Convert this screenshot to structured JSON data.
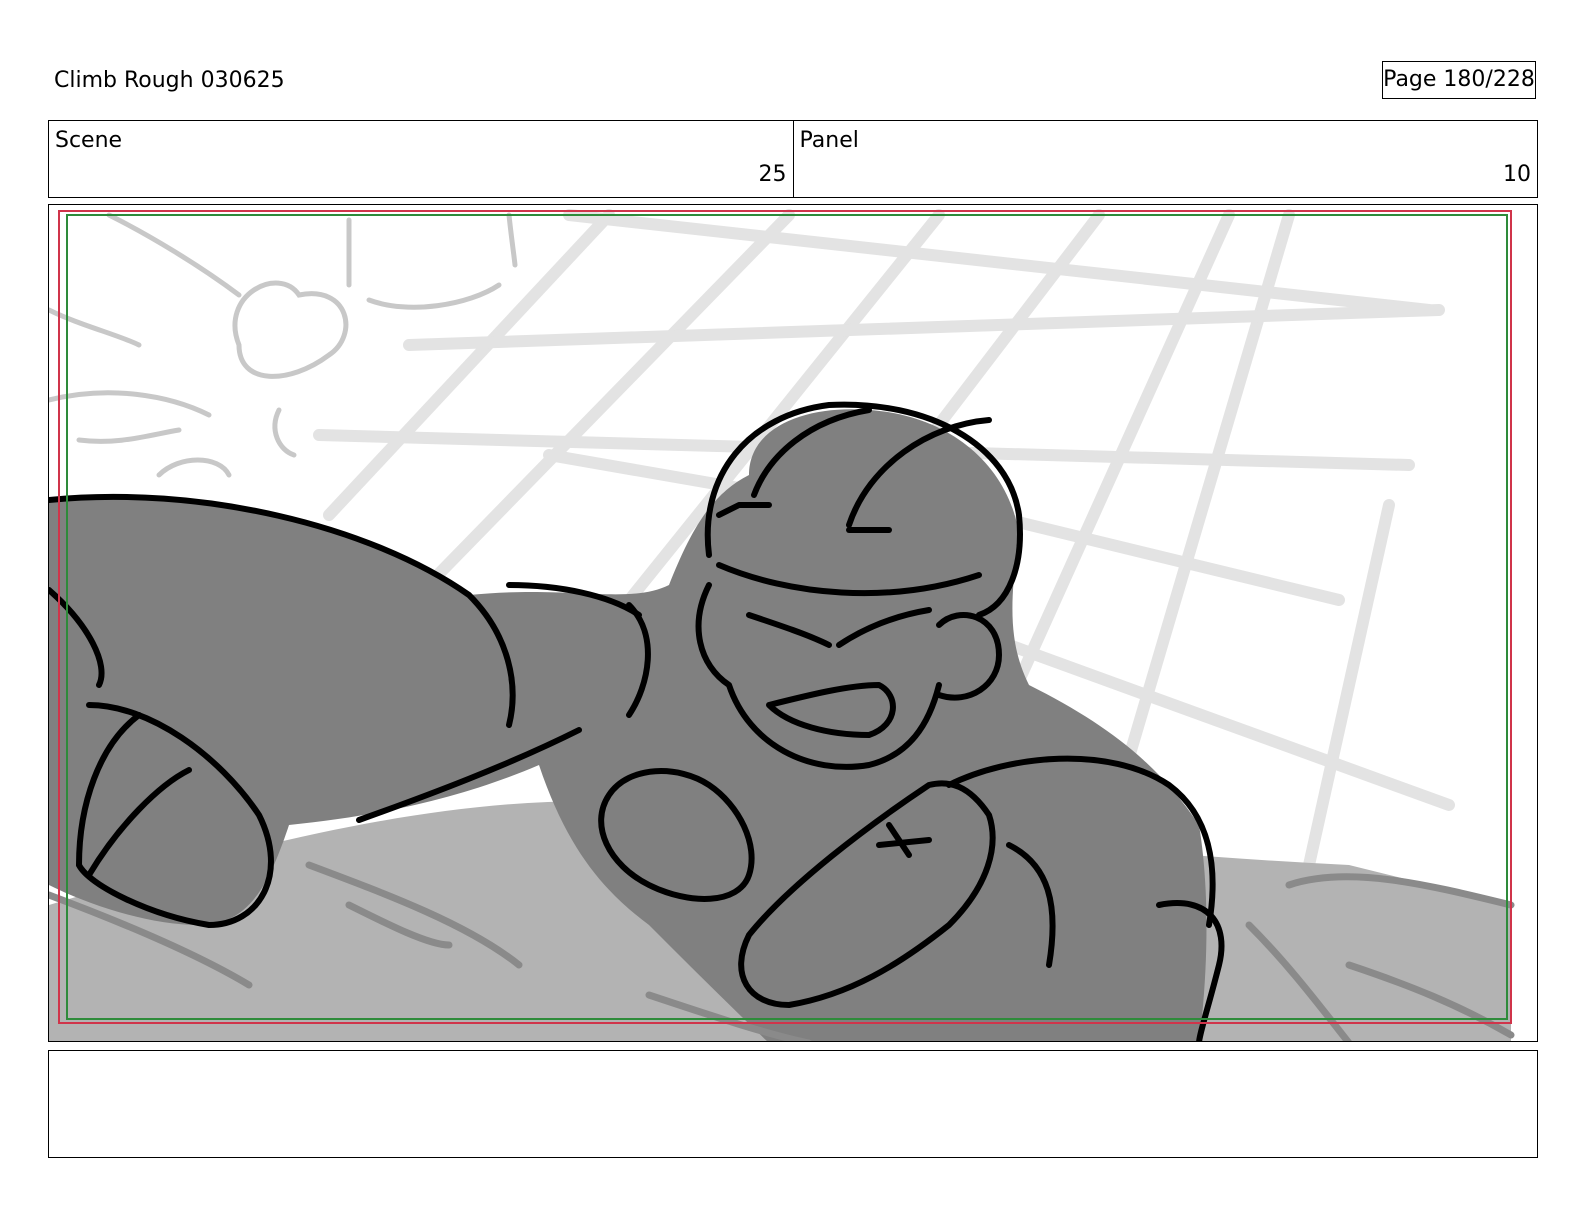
{
  "header": {
    "title": "Climb Rough 030625",
    "page_label": "Page 180/228"
  },
  "info": {
    "scene_label": "Scene",
    "scene_value": "25",
    "panel_label": "Panel",
    "panel_value": "10"
  },
  "sketch": {
    "subject": "climber in helmet reaching forward over bouldering wall",
    "colors": {
      "background": "#ffffff",
      "ground": "#b3b3b3",
      "figure": "#808080",
      "grid": "#e3e3e3",
      "ink": "#000000",
      "safe_area_red": "#d0344a",
      "safe_area_green": "#2e8b3a"
    }
  },
  "notes": {
    "text": ""
  }
}
